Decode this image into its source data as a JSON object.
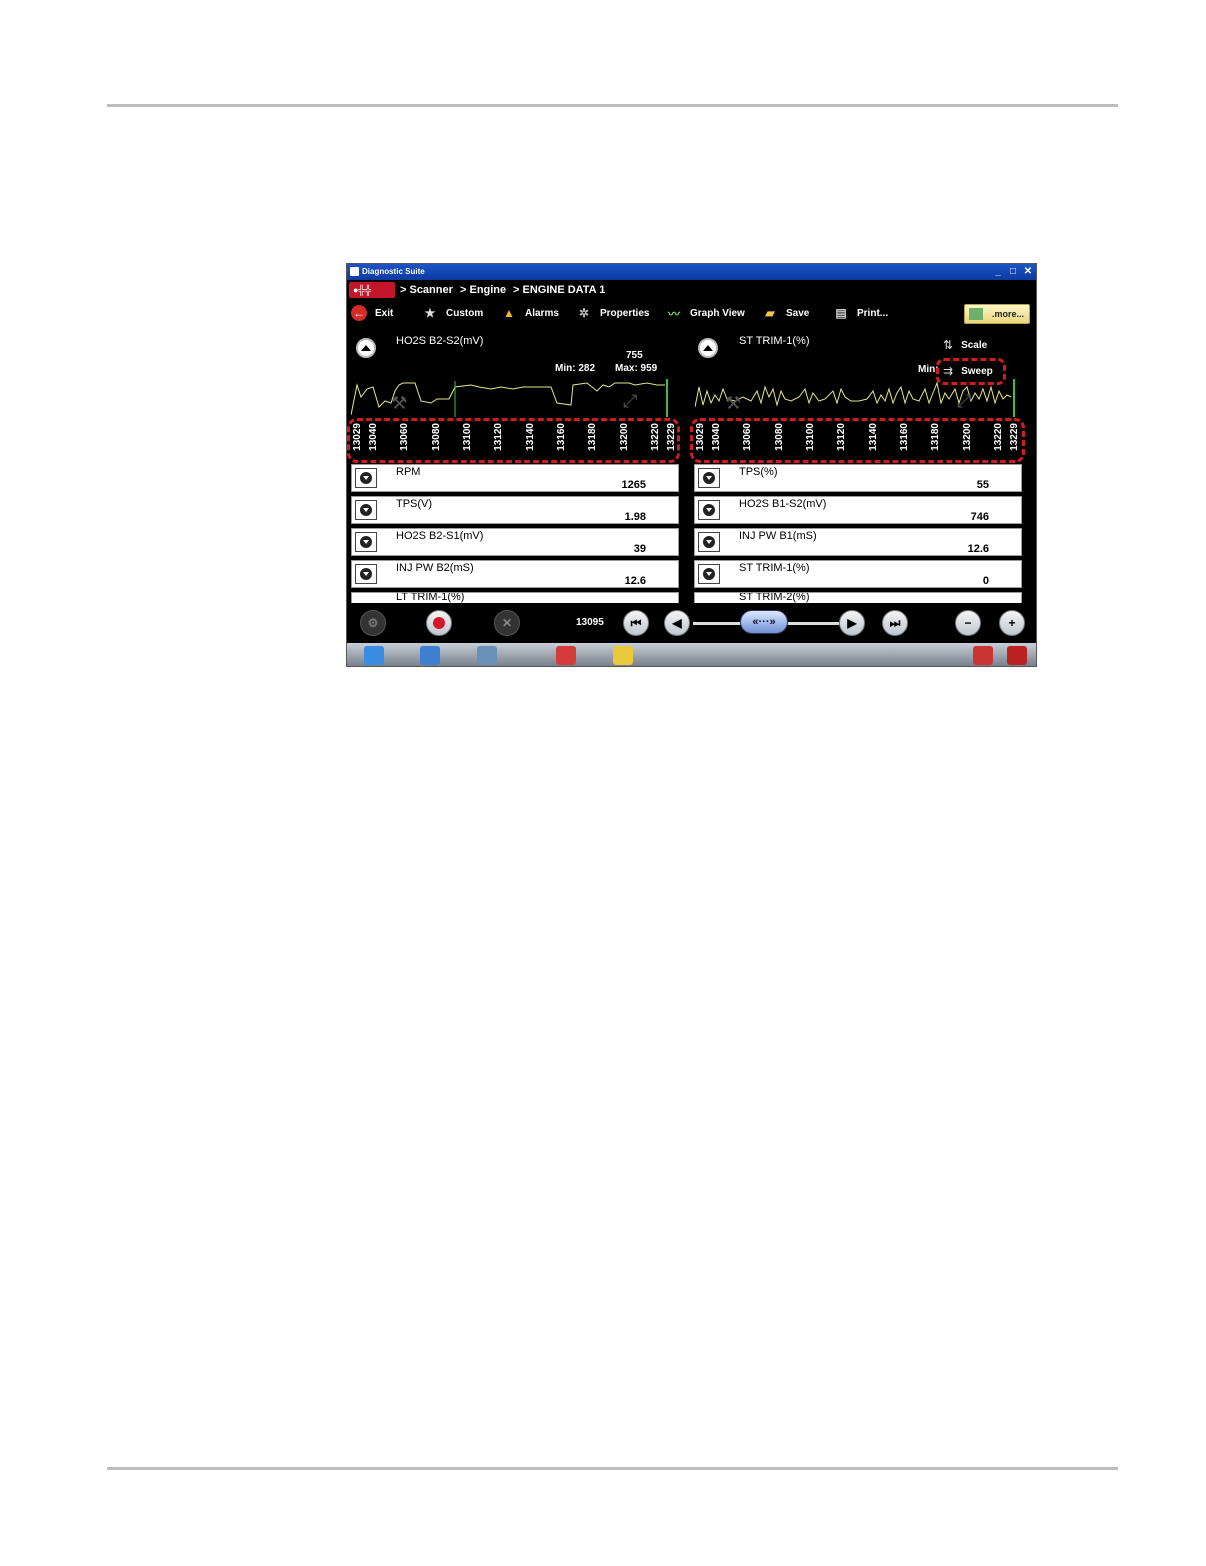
{
  "window": {
    "title": "Diagnostic Suite",
    "minimize": "_",
    "maximize": "□",
    "close": "✕"
  },
  "breadcrumb": [
    "> Scanner",
    "> Engine",
    "> ENGINE DATA 1"
  ],
  "toolbar": {
    "exit": "Exit",
    "custom": "Custom",
    "alarms": "Alarms",
    "properties": "Properties",
    "graph_view": "Graph View",
    "save": "Save",
    "print": "Print...",
    "more": ".more..."
  },
  "graph_left": {
    "title": "HO2S B2-S2(mV)",
    "current": "755",
    "min": "Min: 282",
    "max": "Max: 959",
    "ticks": [
      "13029",
      "13040",
      "13060",
      "13080",
      "13100",
      "13120",
      "13140",
      "13160",
      "13180",
      "13200",
      "13220",
      "13229"
    ]
  },
  "graph_right": {
    "title": "ST TRIM-1(%)",
    "scale": "Scale",
    "sweep": "Sweep",
    "min": "Min:",
    "ticks": [
      "13029",
      "13040",
      "13060",
      "13080",
      "13100",
      "13120",
      "13140",
      "13160",
      "13180",
      "13200",
      "13220",
      "13229"
    ]
  },
  "rows_left": [
    {
      "name": "RPM",
      "value": "1265"
    },
    {
      "name": "TPS(V)",
      "value": "1.98"
    },
    {
      "name": "HO2S B2-S1(mV)",
      "value": "39"
    },
    {
      "name": "INJ PW B2(mS)",
      "value": "12.6"
    }
  ],
  "rows_right": [
    {
      "name": "TPS(%)",
      "value": "55"
    },
    {
      "name": "HO2S B1-S2(mV)",
      "value": "746"
    },
    {
      "name": "INJ PW B1(mS)",
      "value": "12.6"
    },
    {
      "name": "ST TRIM-1(%)",
      "value": "0"
    }
  ],
  "partial_rows": [
    "LT TRIM-1(%)",
    "ST TRIM-2(%)"
  ],
  "controls": {
    "frame": "13095"
  },
  "colors": {
    "trace": "#e6e88a",
    "marker": "#3fbf3f",
    "highlight": "#d21c1c"
  }
}
